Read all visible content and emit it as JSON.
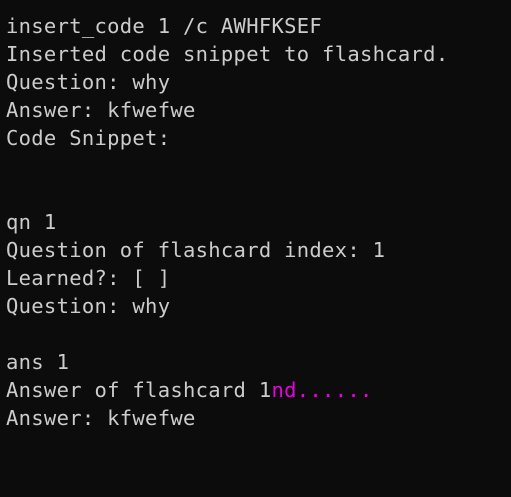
{
  "colors": {
    "background": "#0c0c0c",
    "foreground": "#cccccc",
    "accent": "#e800e0"
  },
  "terminal": {
    "lines": [
      "insert_code 1 /c AWHFKSEF",
      "Inserted code snippet to flashcard.",
      "Question: why",
      "Answer: kfwefwe",
      "Code Snippet:",
      "",
      "",
      "qn 1",
      "Question of flashcard index: 1",
      "Learned?: [ ]",
      "Question: why",
      "",
      "ans 1"
    ],
    "answer_line_prefix": "Answer of flashcard 1",
    "answer_line_accent": "nd......",
    "last_line": "Answer: kfwefwe"
  }
}
